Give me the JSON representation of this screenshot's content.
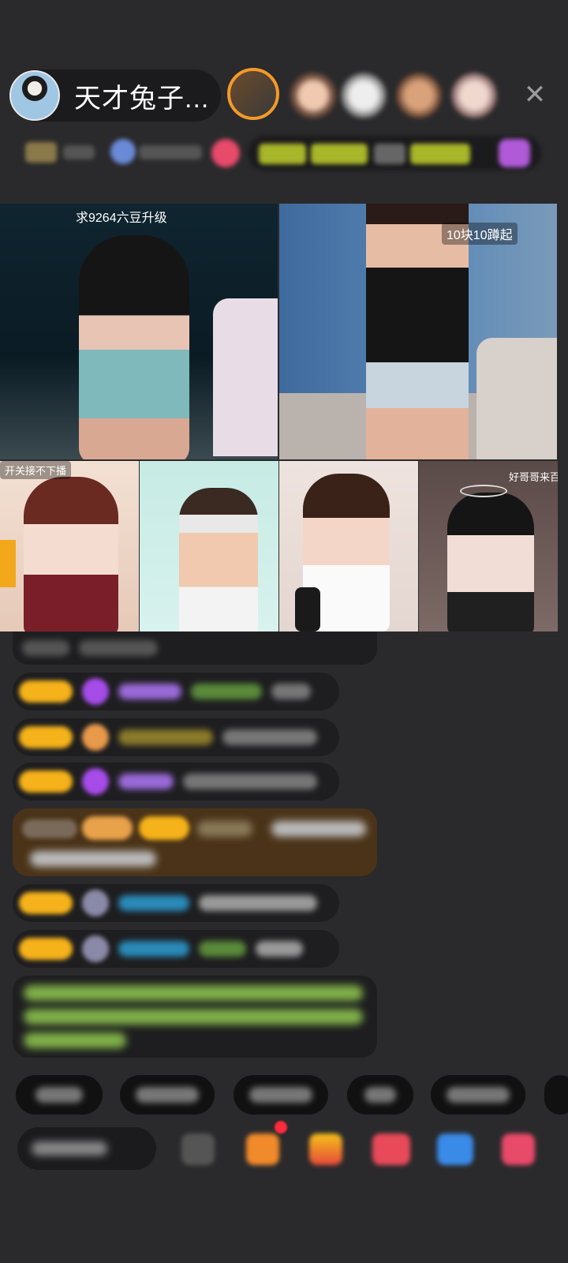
{
  "host": {
    "name": "天才兔子..."
  },
  "video_tiles": [
    {
      "label": "求9264六豆升级"
    },
    {
      "label": "10块10蹲起"
    },
    {
      "label": "开关接不下播"
    },
    {
      "label": ""
    },
    {
      "label": ""
    },
    {
      "label": "好哥哥来百元"
    }
  ],
  "colors": {
    "background": "#2a2a2c",
    "badge_gold": "#f5b21a",
    "highlight_msg": "#4a3318",
    "system_msg_text": "#8fd14f"
  },
  "icons": {
    "close": "close-icon",
    "gift": "gift-icon",
    "diamond": "diamond-icon"
  }
}
